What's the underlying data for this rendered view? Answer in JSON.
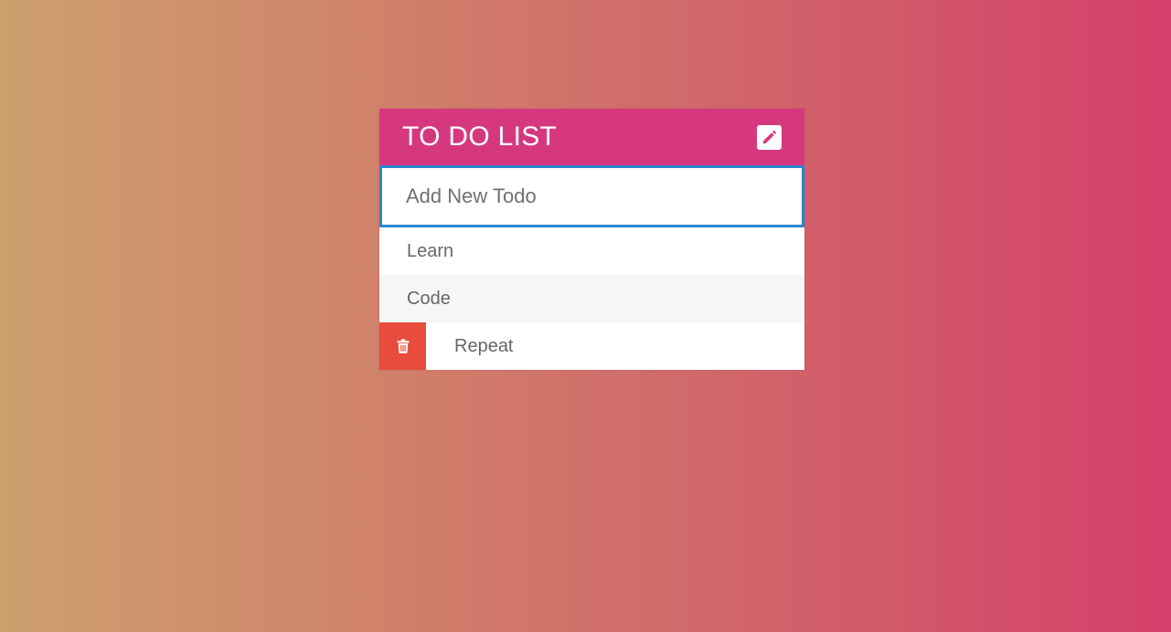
{
  "title": "TO DO LIST",
  "colors": {
    "header": "#d63880",
    "input_border": "#2d86cf",
    "delete": "#e74c3c"
  },
  "header_icon": "pencil-icon",
  "delete_icon": "trash-icon",
  "input": {
    "placeholder": "Add New Todo",
    "value": ""
  },
  "todos": [
    {
      "text": "Learn",
      "hovered": false
    },
    {
      "text": "Code",
      "hovered": false
    },
    {
      "text": "Repeat",
      "hovered": true
    }
  ]
}
